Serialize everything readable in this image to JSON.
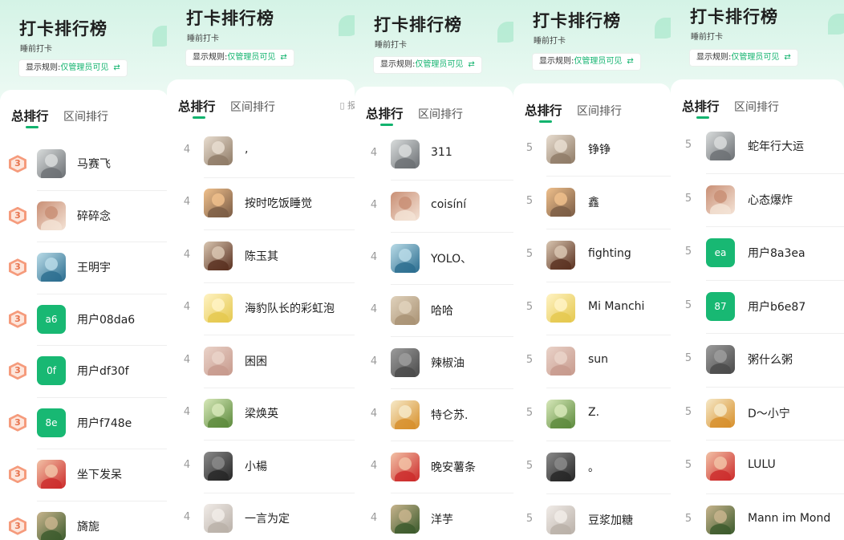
{
  "colors": {
    "accent": "#12b36e",
    "avatar_green": "#18b873",
    "badge3": "#f59b7c"
  },
  "panels": [
    {
      "title": "打卡排行榜",
      "subtitle": "睡前打卡",
      "rule": {
        "label": "显示规则:",
        "value": "仅管理员可见",
        "icon": "swap-icon"
      },
      "tabs": {
        "total": "总排行",
        "interval": "区间排行",
        "extra": ""
      },
      "rows": [
        {
          "rank": "3",
          "name": "马赛飞",
          "avatar": "photo"
        },
        {
          "rank": "3",
          "name": "碎碎念",
          "avatar": "photo"
        },
        {
          "rank": "3",
          "name": "王明宇",
          "avatar": "photo"
        },
        {
          "rank": "3",
          "name": "用户08da6",
          "avatar": "text",
          "avatar_text": "a6"
        },
        {
          "rank": "3",
          "name": "用户df30f",
          "avatar": "text",
          "avatar_text": "0f"
        },
        {
          "rank": "3",
          "name": "用户f748e",
          "avatar": "text",
          "avatar_text": "8e"
        },
        {
          "rank": "3",
          "name": "坐下发呆",
          "avatar": "photo"
        },
        {
          "rank": "3",
          "name": "旖旎",
          "avatar": "photo"
        }
      ]
    },
    {
      "title": "打卡排行榜",
      "subtitle": "睡前打卡",
      "rule": {
        "label": "显示规则:",
        "value": "仅管理员可见",
        "icon": "swap-icon"
      },
      "tabs": {
        "total": "总排行",
        "interval": "区间排行",
        "extra": "报"
      },
      "rows": [
        {
          "rank": "4",
          "name": ",",
          "avatar": "photo"
        },
        {
          "rank": "4",
          "name": "按时吃饭睡觉",
          "avatar": "photo"
        },
        {
          "rank": "4",
          "name": "陈玉其",
          "avatar": "photo"
        },
        {
          "rank": "4",
          "name": "海豹队长的彩虹泡",
          "avatar": "photo"
        },
        {
          "rank": "4",
          "name": "困困",
          "avatar": "photo"
        },
        {
          "rank": "4",
          "name": "梁焕英",
          "avatar": "photo"
        },
        {
          "rank": "4",
          "name": "小楊",
          "avatar": "photo"
        },
        {
          "rank": "4",
          "name": "一言为定",
          "avatar": "photo"
        }
      ]
    },
    {
      "title": "打卡排行榜",
      "subtitle": "睡前打卡",
      "rule": {
        "label": "显示规则:",
        "value": "仅管理员可见",
        "icon": "swap-icon"
      },
      "tabs": {
        "total": "总排行",
        "interval": "区间排行",
        "extra": ""
      },
      "rows": [
        {
          "rank": "4",
          "name": "311",
          "avatar": "photo"
        },
        {
          "rank": "4",
          "name": "coisíní",
          "avatar": "photo"
        },
        {
          "rank": "4",
          "name": "YOLO、",
          "avatar": "photo"
        },
        {
          "rank": "4",
          "name": "哈哈",
          "avatar": "photo"
        },
        {
          "rank": "4",
          "name": "辣椒油",
          "avatar": "photo"
        },
        {
          "rank": "4",
          "name": "特仑苏.",
          "avatar": "photo"
        },
        {
          "rank": "4",
          "name": "晚安薯条",
          "avatar": "photo"
        },
        {
          "rank": "4",
          "name": "洋芋",
          "avatar": "photo"
        }
      ]
    },
    {
      "title": "打卡排行榜",
      "subtitle": "睡前打卡",
      "rule": {
        "label": "显示规则:",
        "value": "仅管理员可见",
        "icon": "swap-icon"
      },
      "tabs": {
        "total": "总排行",
        "interval": "区间排行",
        "extra": ""
      },
      "rows": [
        {
          "rank": "5",
          "name": "铮铮",
          "avatar": "photo"
        },
        {
          "rank": "5",
          "name": "    鑫",
          "avatar": "photo"
        },
        {
          "rank": "5",
          "name": "fighting",
          "avatar": "photo"
        },
        {
          "rank": "5",
          "name": "Mi Manchi",
          "avatar": "photo"
        },
        {
          "rank": "5",
          "name": "sun",
          "avatar": "photo"
        },
        {
          "rank": "5",
          "name": "Z.",
          "avatar": "photo"
        },
        {
          "rank": "5",
          "name": "。",
          "avatar": "photo"
        },
        {
          "rank": "5",
          "name": "豆浆加糖",
          "avatar": "photo"
        }
      ]
    },
    {
      "title": "打卡排行榜",
      "subtitle": "睡前打卡",
      "rule": {
        "label": "显示规则:",
        "value": "仅管理员可见",
        "icon": "swap-icon"
      },
      "tabs": {
        "total": "总排行",
        "interval": "区间排行",
        "extra": ""
      },
      "rows": [
        {
          "rank": "5",
          "name": "蛇年行大运",
          "avatar": "photo"
        },
        {
          "rank": "5",
          "name": "心态爆炸",
          "avatar": "photo"
        },
        {
          "rank": "5",
          "name": "用户8a3ea",
          "avatar": "text",
          "avatar_text": "ea"
        },
        {
          "rank": "5",
          "name": "用户b6e87",
          "avatar": "text",
          "avatar_text": "87"
        },
        {
          "rank": "5",
          "name": "粥什么粥",
          "avatar": "photo"
        },
        {
          "rank": "5",
          "name": "D～小宁",
          "avatar": "photo"
        },
        {
          "rank": "5",
          "name": "LULU",
          "avatar": "photo"
        },
        {
          "rank": "5",
          "name": "Mann im Mond",
          "avatar": "photo"
        }
      ]
    }
  ]
}
